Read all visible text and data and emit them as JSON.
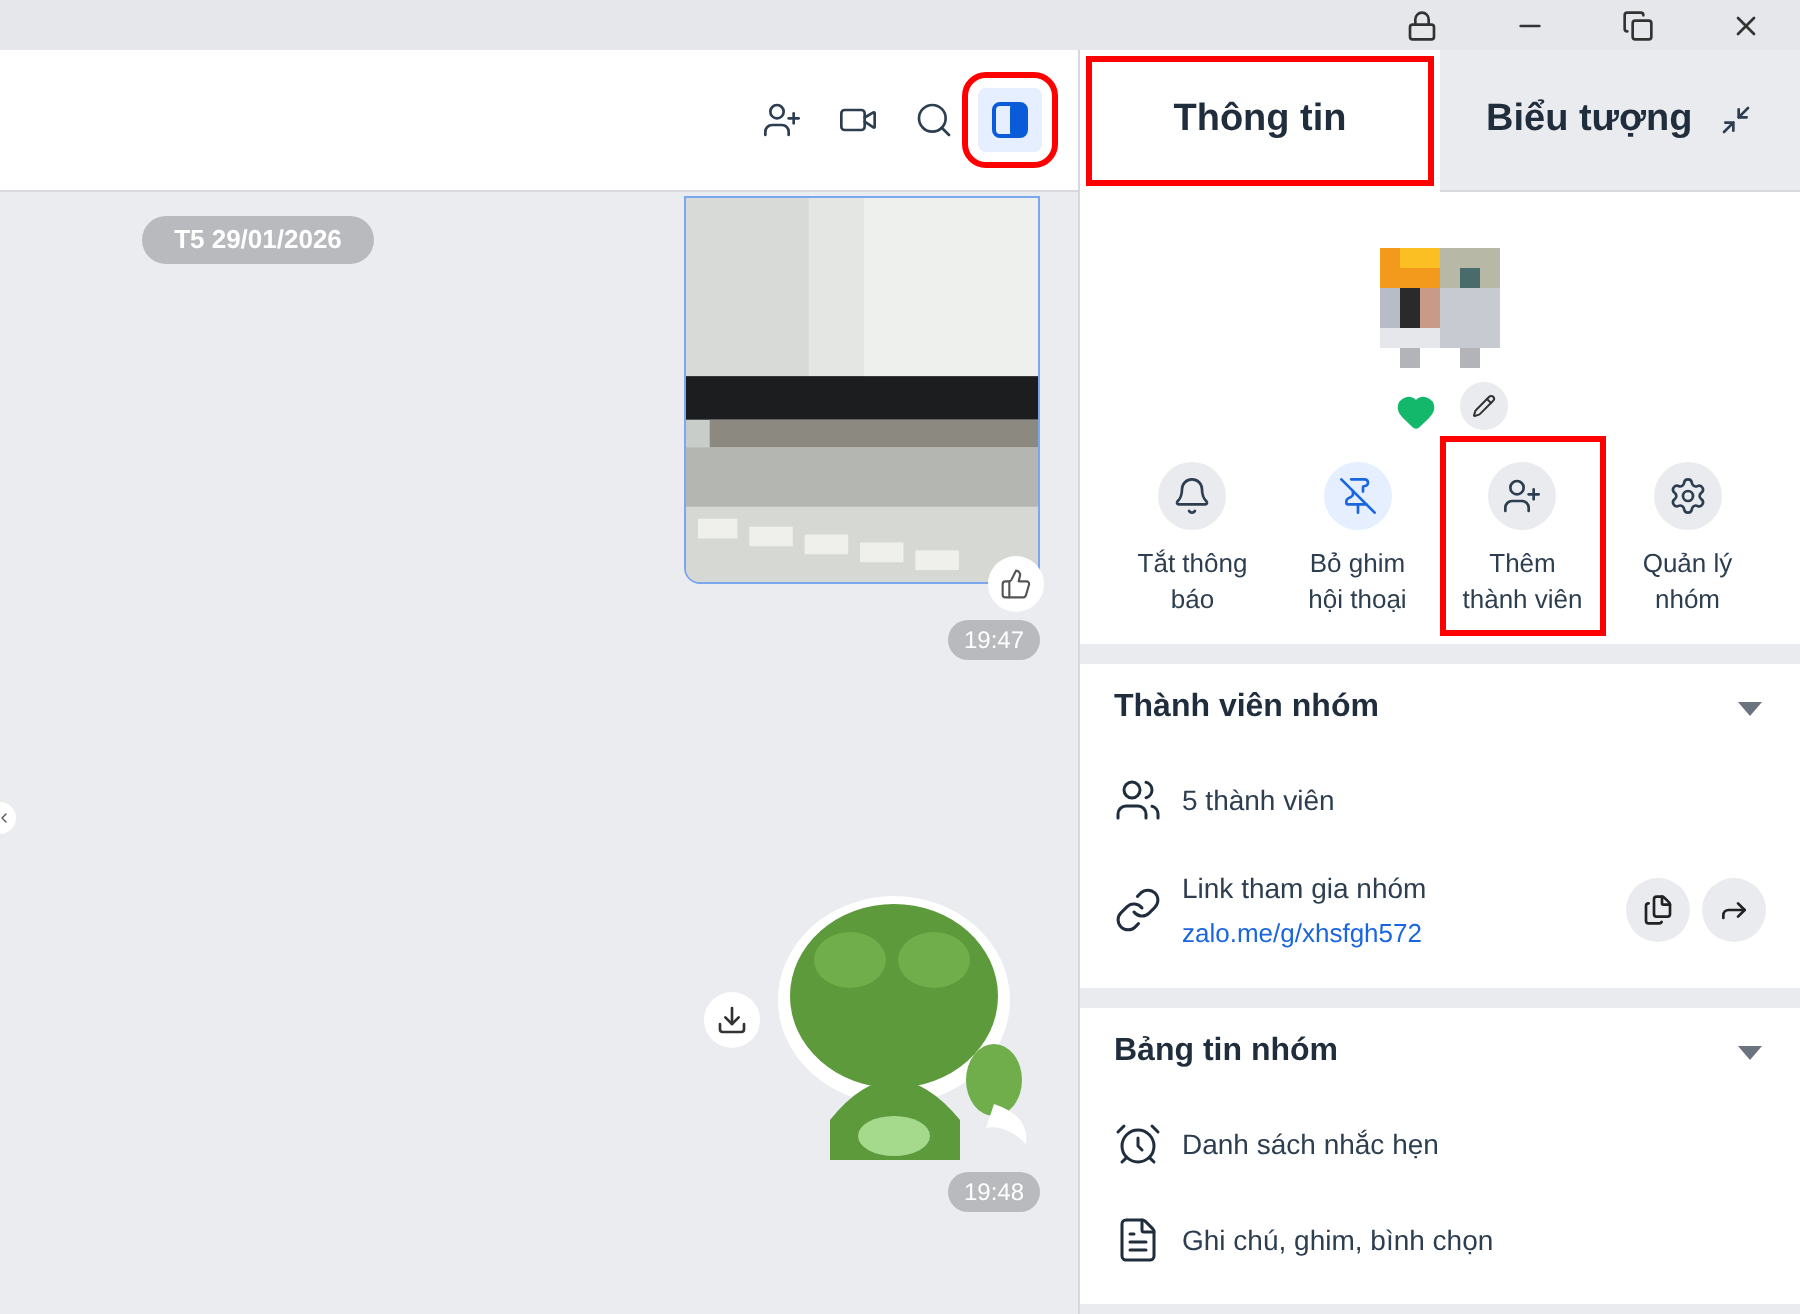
{
  "chat_header": {
    "buttons": [
      {
        "kind": "add-member",
        "selected": false,
        "highlighted": false
      },
      {
        "kind": "video",
        "selected": false,
        "highlighted": false
      },
      {
        "kind": "search",
        "selected": false,
        "highlighted": false
      },
      {
        "kind": "panel",
        "selected": true,
        "highlighted": true
      }
    ]
  },
  "messages": [
    {
      "kind": "date",
      "text": "T5 29/01/2026"
    },
    {
      "time": "19:47"
    },
    {
      "kind": "sticker",
      "time": "19:48"
    }
  ],
  "panel": {
    "tabs": [
      {
        "label": "Thông tin",
        "selected": true,
        "highlighted": true
      },
      {
        "label": "Biểu tượng",
        "selected": false,
        "highlighted": false
      }
    ],
    "actions": [
      {
        "kind": "bell",
        "label": "Tắt thông báo",
        "active": false,
        "highlighted": false
      },
      {
        "kind": "unpin",
        "label": "Bỏ ghim hội thoại",
        "active": true,
        "highlighted": false
      },
      {
        "kind": "add-member",
        "label": "Thêm thành viên",
        "active": false,
        "highlighted": true
      },
      {
        "kind": "settings",
        "label": "Quản lý nhóm",
        "active": false,
        "highlighted": false
      }
    ],
    "sections": [
      {
        "title": "Thành viên nhóm",
        "items": [
          {
            "kind": "members",
            "text": "5 thành viên"
          },
          {
            "kind": "link",
            "text": "Link tham gia nhóm",
            "link": "zalo.me/g/xhsfgh572"
          }
        ]
      },
      {
        "title": "Bảng tin nhóm",
        "items": [
          {
            "kind": "reminder",
            "text": "Danh sách nhắc hẹn"
          },
          {
            "kind": "note",
            "text": "Ghi chú, ghim, bình chọn"
          }
        ]
      }
    ]
  }
}
